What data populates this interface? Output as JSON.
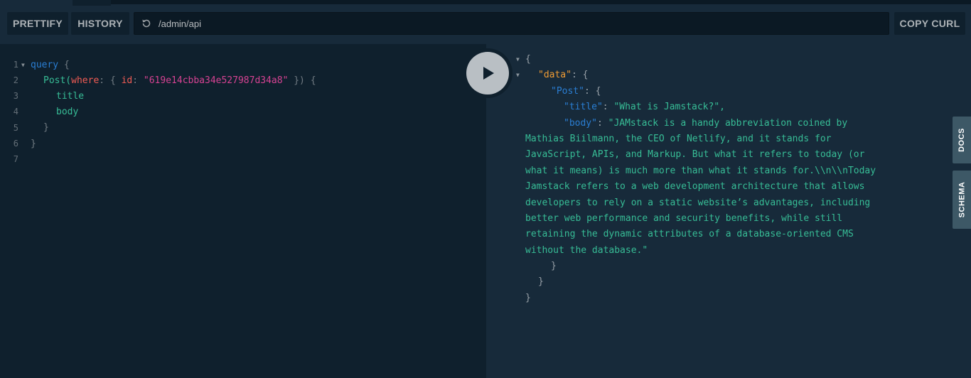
{
  "toolbar": {
    "prettify_label": "PRETTIFY",
    "history_label": "HISTORY",
    "url_value": "/admin/api",
    "copy_curl_label": "COPY CURL"
  },
  "editor": {
    "line_numbers": [
      "1",
      "2",
      "3",
      "4",
      "5",
      "6",
      "7"
    ],
    "query_keyword": "query",
    "open_brace": "{",
    "post_op": "Post(",
    "where_arg": "where",
    "colon": ":",
    "inner_open": "{",
    "id_field": "id",
    "id_value": "\"619e14cbba34e527987d34a8\"",
    "inner_close": "})",
    "brace_after": "{",
    "field_title": "title",
    "field_body": "body",
    "close_brace": "}"
  },
  "results": {
    "open": "{",
    "data_key": "\"data\"",
    "post_key": "\"Post\"",
    "title_key": "\"title\"",
    "title_value": "\"What is Jamstack?\",",
    "body_key": "\"body\"",
    "body_value_lines": [
      "\"JAMstack is a handy abbreviation coined by",
      "Mathias Biilmann, the CEO of Netlify, and it stands for",
      "JavaScript, APIs, and Markup. But what it refers to today (or",
      "what it means) is much more than what it stands for.\\\\n\\\\nToday",
      "Jamstack refers to a web development architecture that allows",
      "developers to rely on a static website’s advantages, including",
      "better web performance and security benefits, while still",
      "retaining the dynamic attributes of a database-oriented CMS",
      "without the database.\""
    ],
    "colon_brace": ": {",
    "colon": ": ",
    "close": "}"
  },
  "side_tabs": {
    "docs": "DOCS",
    "schema": "SCHEMA"
  },
  "icons": {
    "reload": "reload-icon",
    "play": "play-icon",
    "fold": "fold-arrow-icon"
  },
  "colors": {
    "editor_bg": "#0f202d",
    "results_bg": "#172a3a",
    "keyword": "#2a7ed3",
    "field": "#37bd96",
    "argument": "#f25c54",
    "string_arg": "#d64292",
    "json_top_key": "#f09c34"
  }
}
